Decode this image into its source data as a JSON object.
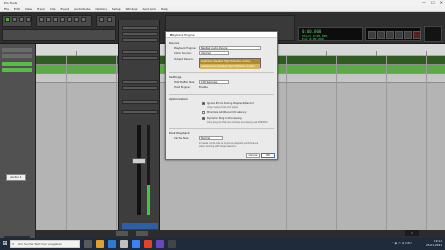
{
  "window": {
    "app_title": "Pro Tools",
    "minimize_glyph": "—",
    "maximize_glyph": "☐",
    "close_glyph": "✕"
  },
  "menu": {
    "items": [
      "File",
      "Edit",
      "View",
      "Track",
      "Clip",
      "Event",
      "AudioSuite",
      "Options",
      "Setup",
      "Window",
      "Avid Link",
      "Help"
    ]
  },
  "counter": {
    "main": "0:00.000",
    "sub_lines": [
      "Start 0:00.000",
      "End 0:00.000",
      "Length 0:00.000"
    ]
  },
  "transport": {
    "buttons": [
      "rtz-icon",
      "rewind-icon",
      "forward-icon",
      "stop-icon",
      "play-icon",
      "record-icon"
    ]
  },
  "left_panel": {
    "selected_track_label": "Audio 1",
    "bottom_label": "EDIT"
  },
  "dialog": {
    "title": "Playback Engine",
    "close_glyph": "✕",
    "section_device": "Device",
    "playback_engine_label": "Playback Engine:",
    "playback_engine_value": "Realtek Audio Device",
    "clock_source_label": "Clock Source:",
    "clock_source_value": "Internal",
    "output_device_label": "Output Device:",
    "dropdown_items": [
      "Kopfhörer (Realtek High Definition Audio)",
      "Lautsprecher (Realtek High Definition Audio)"
    ],
    "section_settings": "Settings",
    "hw_buffer_label": "H/W Buffer Size:",
    "hw_buffer_value": "128 Samples",
    "host_engine_label": "Host Engine:",
    "host_engine_value": "Enable",
    "section_options": "Optimization",
    "opt_dynamic": "Ignore Errors During Playback/Record",
    "opt_dynamic_note": "(may cause clicks and pops)",
    "opt_minimize": "Minimize Additional I/O Latency",
    "opt_dynamic_plugin": "Dynamic Plug-In Processing",
    "opt_dynamic_plugin_note": "Only plug-ins that are actively processing use DSP/CPU.",
    "section_disk": "Disk Playback",
    "cache_size_label": "Cache Size:",
    "cache_size_value": "Normal",
    "cache_note_1": "Increase cache size to improve playback performance",
    "cache_note_2": "when working with large sessions.",
    "ok_label": "OK",
    "cancel_label": "Cancel"
  },
  "taskbar": {
    "search_placeholder": "Zur Suche Text hier eingeben",
    "time": "19:11",
    "date": "25.01.2021",
    "tray_text": "ˆ  ◉  ▭  ⊕  DEU"
  },
  "session": {
    "page_indicator": "1"
  },
  "colors": {
    "region_green": "#5caa45",
    "dropdown_highlight": "#b38b2a",
    "counter_green": "#55d06a",
    "taskbar": "#1f2a3a"
  }
}
